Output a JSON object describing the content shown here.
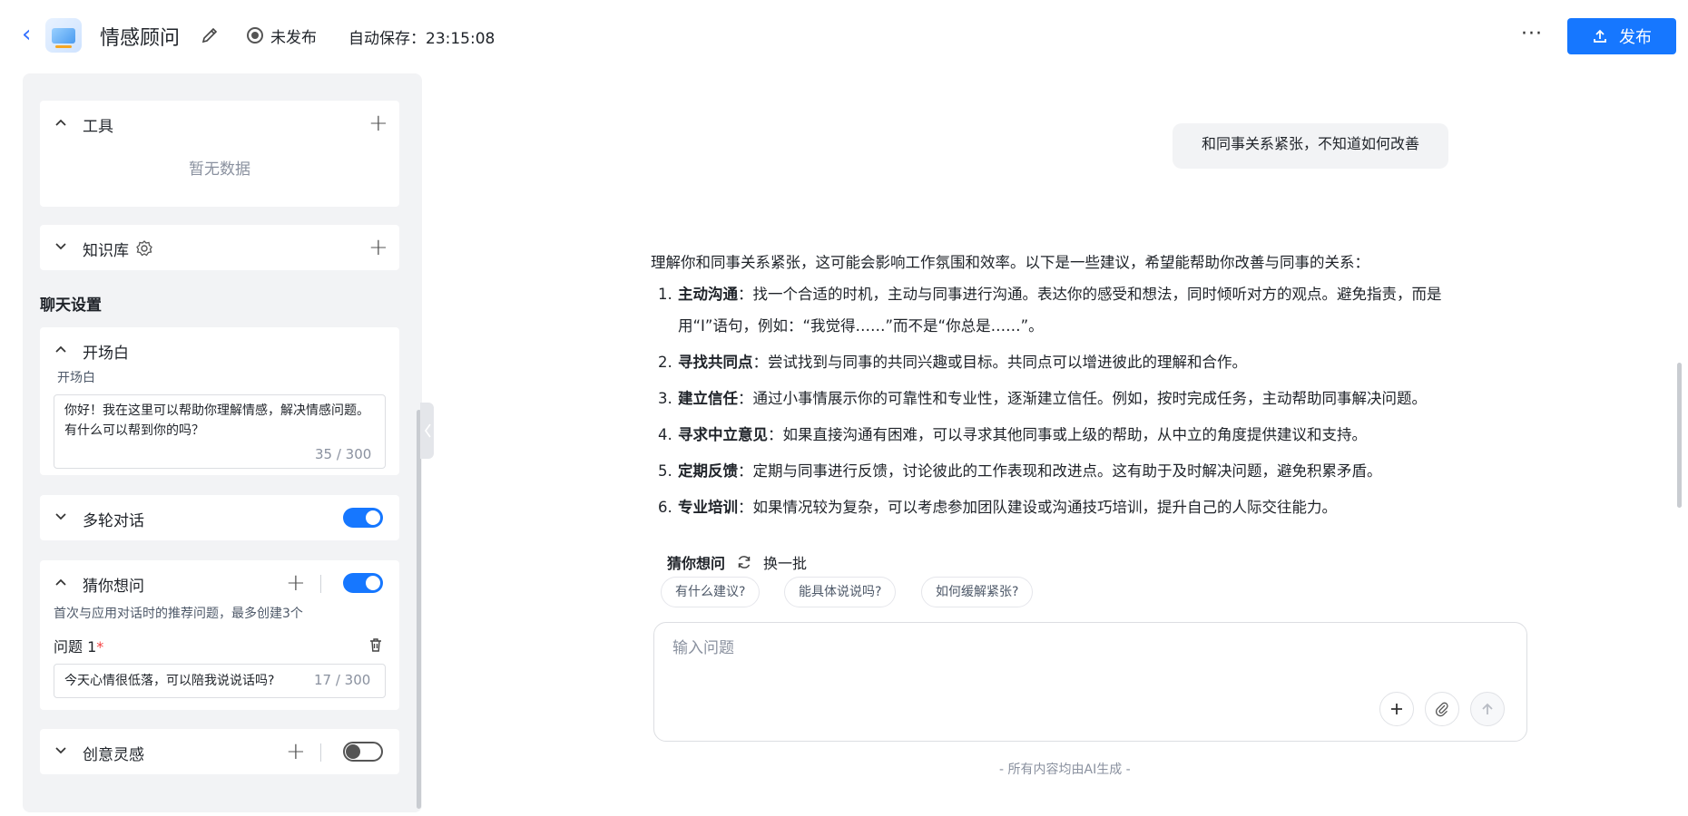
{
  "header": {
    "app_title": "情感顾问",
    "status_label": "未发布",
    "autosave": "自动保存：23:15:08",
    "publish_label": "发布",
    "more_label": "···"
  },
  "left_panel": {
    "tools": {
      "title": "工具",
      "empty": "暂无数据"
    },
    "knowledge": {
      "title": "知识库"
    },
    "chat_settings_title": "聊天设置",
    "opening": {
      "title": "开场白",
      "field_label": "开场白",
      "value": "你好！我在这里可以帮助你理解情感，解决情感问题。有什么可以帮到你的吗？",
      "counter": "35 / 300"
    },
    "multi_turn": {
      "title": "多轮对话",
      "enabled": true
    },
    "guess": {
      "title": "猜你想问",
      "enabled": true,
      "desc": "首次与应用对话时的推荐问题，最多创建3个",
      "q_label": "问题 1",
      "required": "*",
      "q_value": "今天心情很低落，可以陪我说说话吗?",
      "q_counter": "17 / 300"
    },
    "creative": {
      "title": "创意灵感",
      "enabled": false
    }
  },
  "chat": {
    "user_message": "和同事关系紧张，不知道如何改善",
    "answer_intro": "理解你和同事关系紧张，这可能会影响工作氛围和效率。以下是一些建议，希望能帮助你改善与同事的关系：",
    "answer_items": [
      {
        "bold": "主动沟通",
        "text": "：找一个合适的时机，主动与同事进行沟通。表达你的感受和想法，同时倾听对方的观点。避免指责，而是用“I”语句，例如：“我觉得……”而不是“你总是……”。"
      },
      {
        "bold": "寻找共同点",
        "text": "：尝试找到与同事的共同兴趣或目标。共同点可以增进彼此的理解和合作。"
      },
      {
        "bold": "建立信任",
        "text": "：通过小事情展示你的可靠性和专业性，逐渐建立信任。例如，按时完成任务，主动帮助同事解决问题。"
      },
      {
        "bold": "寻求中立意见",
        "text": "：如果直接沟通有困难，可以寻求其他同事或上级的帮助，从中立的角度提供建议和支持。"
      },
      {
        "bold": "定期反馈",
        "text": "：定期与同事进行反馈，讨论彼此的工作表现和改进点。这有助于及时解决问题，避免积累矛盾。"
      },
      {
        "bold": "专业培训",
        "text": "：如果情况较为复杂，可以考虑参加团队建设或沟通技巧培训，提升自己的人际交往能力。"
      }
    ],
    "suggest_title": "猜你想问",
    "refresh_label": "换一批",
    "suggestions": [
      "有什么建议?",
      "能具体说说吗?",
      "如何缓解紧张?"
    ],
    "input_placeholder": "输入问题",
    "footer_note": "- 所有内容均由AI生成 -"
  },
  "colors": {
    "accent": "#1677ff",
    "panel_bg": "#f2f3f5"
  }
}
